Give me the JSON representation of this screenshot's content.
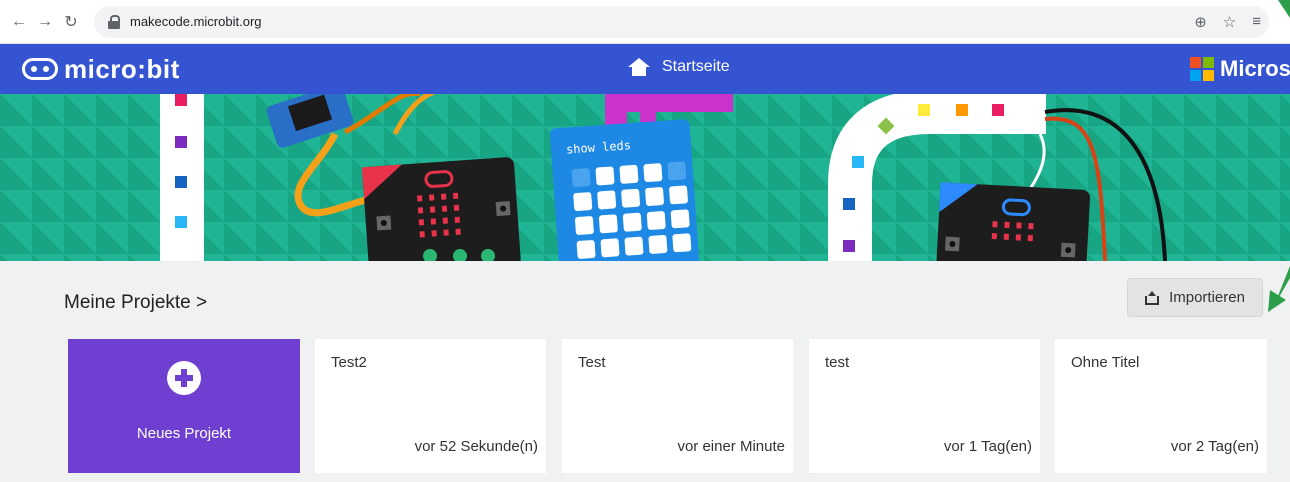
{
  "browser": {
    "url": "makecode.microbit.org"
  },
  "header": {
    "logo_text": "micro:bit",
    "home_label": "Startseite",
    "brand_text": "Micros",
    "colors": {
      "bar": "#3454d1",
      "ms_red": "#f25022",
      "ms_green": "#7fba00",
      "ms_blue": "#00a4ef",
      "ms_yellow": "#ffb900"
    }
  },
  "banner": {
    "code_block_label": "show leds"
  },
  "projects": {
    "title": "Meine Projekte >",
    "import_label": "Importieren",
    "new_project_label": "Neues Projekt",
    "items": [
      {
        "name": "Test2",
        "time": "vor 52 Sekunde(n)"
      },
      {
        "name": "Test",
        "time": "vor einer Minute"
      },
      {
        "name": "test",
        "time": "vor 1 Tag(en)"
      },
      {
        "name": "Ohne Titel",
        "time": "vor 2 Tag(en)"
      }
    ]
  },
  "colors": {
    "new_project_bg": "#6e3fd0",
    "banner_bg": "#1fb594",
    "annotation_green": "#2e9e4a"
  }
}
